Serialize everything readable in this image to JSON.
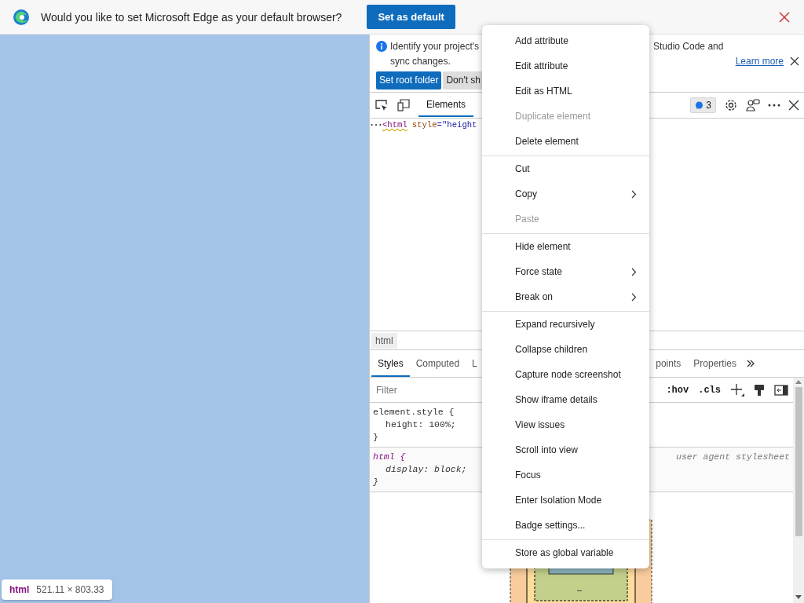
{
  "infobar": {
    "question": "Would you like to set Microsoft Edge as your default browser?",
    "button": "Set as default"
  },
  "devtools": {
    "notification": {
      "text_start": "Identify your project's",
      "text_end": "Studio Code and",
      "text_line2": "sync changes.",
      "link": "Learn more",
      "buttons": [
        {
          "label": "Set root folder",
          "primary": true
        },
        {
          "label": "Don't sh",
          "primary": false
        }
      ]
    },
    "toolbar": {
      "tabs": [
        {
          "label": "Elements",
          "selected": true
        }
      ],
      "issues_count": "3"
    },
    "dom_line": {
      "tag": "<html",
      "attr_name": "style",
      "attr_rest": "=\"height"
    },
    "breadcrumb": "html",
    "sidebar_tabs": [
      {
        "label": "Styles",
        "selected": true
      },
      {
        "label": "Computed",
        "selected": false
      },
      {
        "label": "L",
        "selected": false
      },
      {
        "label": "points",
        "selected": false
      },
      {
        "label": "Properties",
        "selected": false
      }
    ],
    "filter": {
      "placeholder": "Filter",
      "hov": ":hov",
      "cls": ".cls"
    },
    "rules": [
      {
        "selector": "element.style {",
        "declaration": "height: 100%;",
        "close": "}",
        "user_agent": false
      },
      {
        "selector": "html {",
        "declaration": "display: block;",
        "close": "}",
        "source": "user agent stylesheet",
        "user_agent": true
      }
    ],
    "box_model": {
      "padding_bottom": "–"
    }
  },
  "context_menu": [
    [
      {
        "label": "Add attribute",
        "disabled": false,
        "submenu": false
      },
      {
        "label": "Edit attribute",
        "disabled": false,
        "submenu": false
      },
      {
        "label": "Edit as HTML",
        "disabled": false,
        "submenu": false
      },
      {
        "label": "Duplicate element",
        "disabled": true,
        "submenu": false
      },
      {
        "label": "Delete element",
        "disabled": false,
        "submenu": false
      }
    ],
    [
      {
        "label": "Cut",
        "disabled": false,
        "submenu": false
      },
      {
        "label": "Copy",
        "disabled": false,
        "submenu": true
      },
      {
        "label": "Paste",
        "disabled": true,
        "submenu": false
      }
    ],
    [
      {
        "label": "Hide element",
        "disabled": false,
        "submenu": false
      },
      {
        "label": "Force state",
        "disabled": false,
        "submenu": true
      },
      {
        "label": "Break on",
        "disabled": false,
        "submenu": true
      }
    ],
    [
      {
        "label": "Expand recursively",
        "disabled": false,
        "submenu": false
      },
      {
        "label": "Collapse children",
        "disabled": false,
        "submenu": false
      },
      {
        "label": "Capture node screenshot",
        "disabled": false,
        "submenu": false
      },
      {
        "label": "Show iframe details",
        "disabled": false,
        "submenu": false
      },
      {
        "label": "View issues",
        "disabled": false,
        "submenu": false
      },
      {
        "label": "Scroll into view",
        "disabled": false,
        "submenu": false
      },
      {
        "label": "Focus",
        "disabled": false,
        "submenu": false
      },
      {
        "label": "Enter Isolation Mode",
        "disabled": false,
        "submenu": false
      },
      {
        "label": "Badge settings...",
        "disabled": false,
        "submenu": false
      }
    ],
    [
      {
        "label": "Store as global variable",
        "disabled": false,
        "submenu": false
      }
    ]
  ],
  "tooltip": {
    "tag": "html",
    "size": "521.11 × 803.33"
  }
}
